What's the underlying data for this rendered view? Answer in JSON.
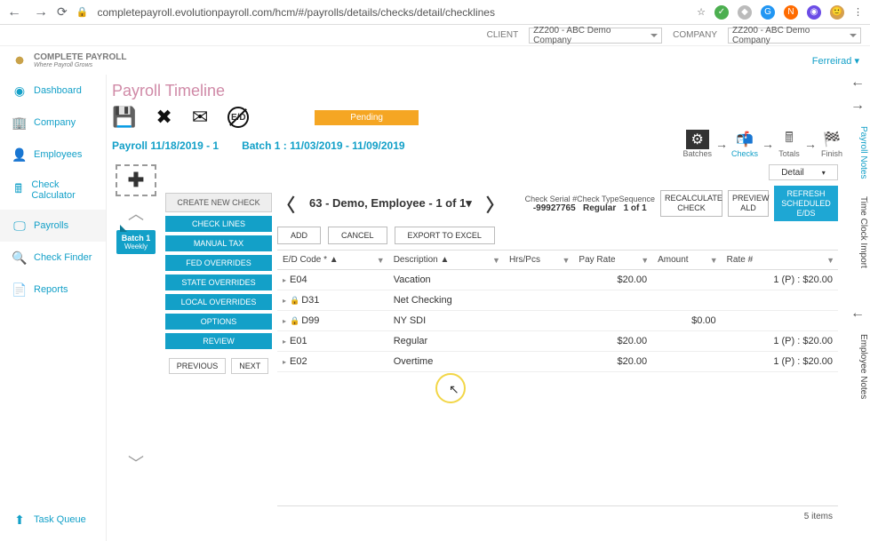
{
  "chrome": {
    "url": "completepayroll.evolutionpayroll.com/hcm/#/payrolls/details/checks/detail/checklines"
  },
  "clientbar": {
    "client_label": "CLIENT",
    "client_value": "ZZ200 - ABC Demo Company",
    "company_label": "COMPANY",
    "company_value": "ZZ200 - ABC Demo Company"
  },
  "logo": {
    "text": "COMPLETE PAYROLL",
    "sub": "Where Payroll Grows"
  },
  "user": "Ferreirad",
  "sidebar": [
    {
      "label": "Dashboard",
      "icon": "◉"
    },
    {
      "label": "Company",
      "icon": "🏢"
    },
    {
      "label": "Employees",
      "icon": "👤"
    },
    {
      "label": "Check Calculator",
      "icon": "🖩"
    },
    {
      "label": "Payrolls",
      "icon": "🖵"
    },
    {
      "label": "Check Finder",
      "icon": "🔍"
    },
    {
      "label": "Reports",
      "icon": "📄"
    }
  ],
  "taskqueue": "Task Queue",
  "page_title": "Payroll Timeline",
  "pending": "Pending",
  "path": {
    "payroll": "Payroll 11/18/2019 - 1",
    "batch": "Batch 1 : 11/03/2019 - 11/09/2019"
  },
  "steps": [
    "Batches",
    "Checks",
    "Totals",
    "Finish"
  ],
  "batch_card": {
    "title": "Batch 1",
    "sub": "Weekly"
  },
  "checkpanel": {
    "create": "CREATE NEW CHECK",
    "tabs": [
      "CHECK LINES",
      "MANUAL TAX",
      "FED OVERRIDES",
      "STATE OVERRIDES",
      "LOCAL OVERRIDES",
      "OPTIONS",
      "REVIEW"
    ],
    "prev": "PREVIOUS",
    "next": "NEXT"
  },
  "detail_dd": "Detail",
  "emp_nav": "63 - Demo, Employee  - 1 of 1",
  "meta_labels": "Check Serial #Check TypeSequence",
  "meta_values": {
    "serial": "-99927765",
    "type": "Regular",
    "seq": "1 of 1"
  },
  "pillbtns": {
    "recalc": "RECALCULATE CHECK",
    "preview": "PREVIEW ALD",
    "refresh": "REFRESH SCHEDULED E/DS"
  },
  "gactions": {
    "add": "ADD",
    "cancel": "CANCEL",
    "export": "EXPORT TO EXCEL"
  },
  "columns": [
    "E/D Code * ▲",
    "Description ▲",
    "Hrs/Pcs",
    "Pay Rate",
    "Amount",
    "Rate #"
  ],
  "rows": [
    {
      "code": "E04",
      "lock": false,
      "desc": "Vacation",
      "hrs": "",
      "pay": "$20.00",
      "amt": "",
      "rate": "1 (P) : $20.00"
    },
    {
      "code": "D31",
      "lock": true,
      "desc": "Net Checking",
      "hrs": "",
      "pay": "",
      "amt": "",
      "rate": ""
    },
    {
      "code": "D99",
      "lock": true,
      "desc": "NY SDI",
      "hrs": "",
      "pay": "",
      "amt": "$0.00",
      "rate": ""
    },
    {
      "code": "E01",
      "lock": false,
      "desc": "Regular",
      "hrs": "",
      "pay": "$20.00",
      "amt": "",
      "rate": "1 (P) : $20.00"
    },
    {
      "code": "E02",
      "lock": false,
      "desc": "Overtime",
      "hrs": "",
      "pay": "$20.00",
      "amt": "",
      "rate": "1 (P) : $20.00"
    }
  ],
  "itemcount": "5 items",
  "rtabs": [
    "Payroll Notes",
    "Time Clock Import",
    "Employee Notes"
  ]
}
